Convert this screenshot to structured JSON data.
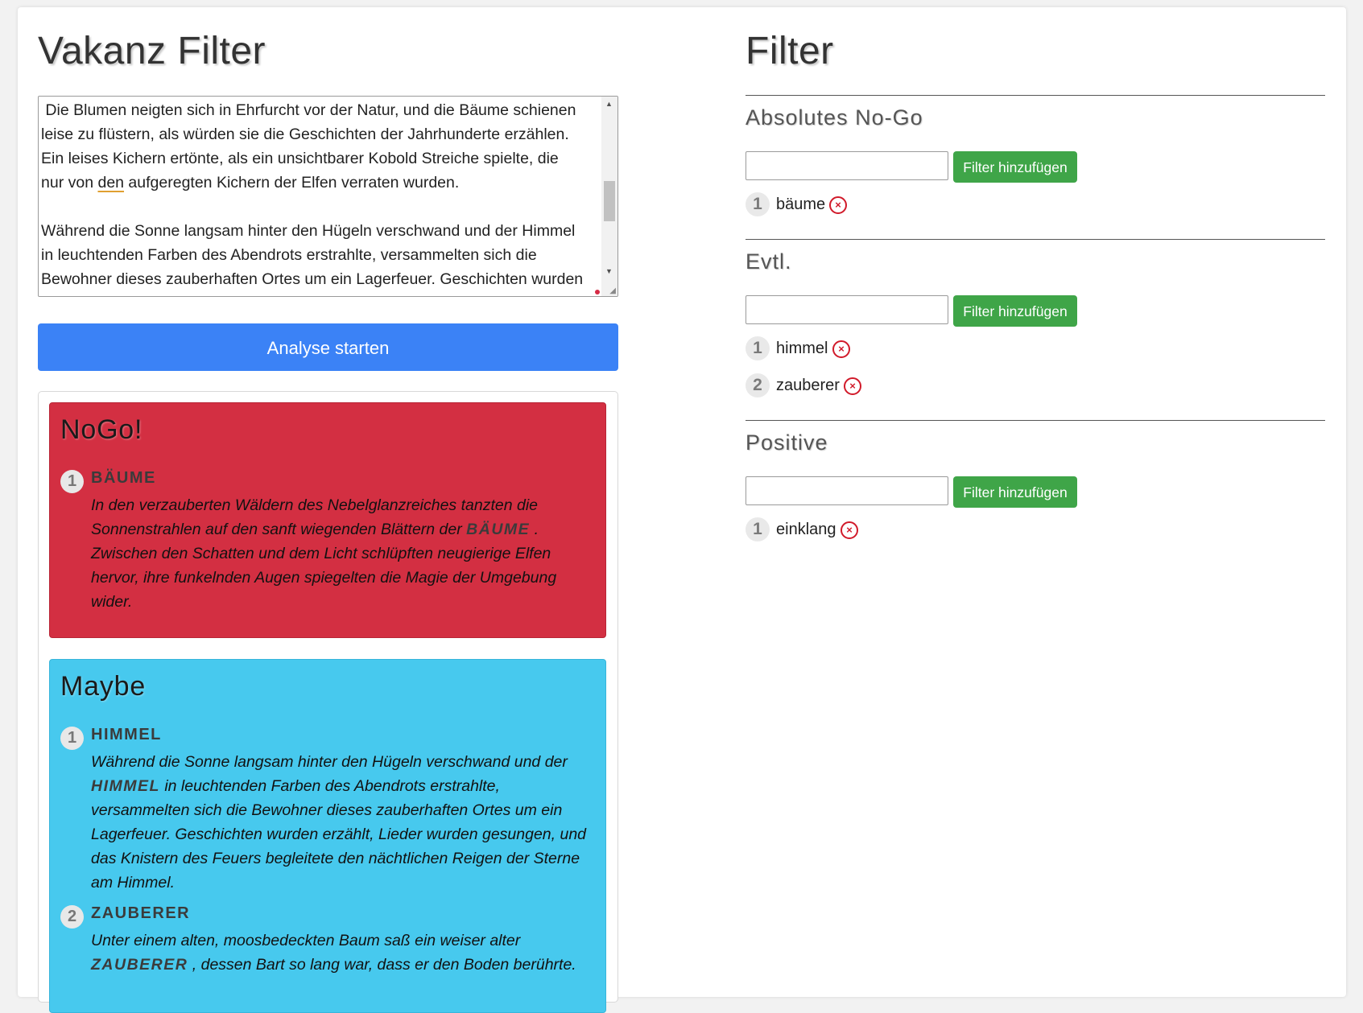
{
  "left": {
    "title": "Vakanz Filter",
    "text_lines": [
      " Die Blumen neigten sich in Ehrfurcht vor der Natur, und die Bäume schienen",
      "leise zu flüstern, als würden sie die Geschichten der Jahrhunderte erzählen.",
      "Ein leises Kichern ertönte, als ein unsichtbarer Kobold Streiche spielte, die",
      "nur von ",
      "den",
      " aufgeregten Kichern der Elfen verraten wurden.",
      "Während die Sonne langsam hinter den Hügeln verschwand und der Himmel",
      "in leuchtenden Farben des Abendrots erstrahlte, versammelten sich die",
      "Bewohner dieses zauberhaften Ortes um ein Lagerfeuer. Geschichten wurden"
    ],
    "analyse_button": "Analyse starten"
  },
  "results": {
    "nogo": {
      "title": "NoGo!",
      "color": "#d32f42",
      "hits": [
        {
          "num": "1",
          "word": "BÄUME",
          "text_before": "In den verzauberten Wäldern des Nebelglanzreiches tanzten die Sonnenstrahlen auf den sanft wiegenden Blättern der ",
          "keyword": "Bäume",
          "text_after": " . Zwischen den Schatten und dem Licht schlüpften neugierige Elfen hervor, ihre funkelnden Augen spiegelten die Magie der Umgebung wider."
        }
      ]
    },
    "maybe": {
      "title": "Maybe",
      "color": "#47c9ee",
      "hits": [
        {
          "num": "1",
          "word": "HIMMEL",
          "text_before": "Während die Sonne langsam hinter den Hügeln verschwand und der ",
          "keyword": "Himmel",
          "text_after": " in leuchtenden Farben des Abendrots erstrahlte, versammelten sich die Bewohner dieses zauberhaften Ortes um ein Lagerfeuer. Geschichten wurden erzählt, Lieder wurden gesungen, und das Knistern des Feuers begleitete den nächtlichen Reigen der Sterne am Himmel."
        },
        {
          "num": "2",
          "word": "ZAUBERER",
          "text_before": "Unter einem alten, moosbedeckten Baum saß ein weiser alter ",
          "keyword": "Zauberer",
          "text_after": " , dessen Bart so lang war, dass er den Boden berührte."
        }
      ]
    }
  },
  "filter": {
    "title": "Filter",
    "add_button": "Filter hinzufügen",
    "remove_symbol": "×",
    "sections": [
      {
        "title": "Absolutes No-Go",
        "input_value": "",
        "items": [
          {
            "num": "1",
            "label": "bäume"
          }
        ]
      },
      {
        "title": "Evtl.",
        "input_value": "",
        "items": [
          {
            "num": "1",
            "label": "himmel"
          },
          {
            "num": "2",
            "label": "zauberer"
          }
        ]
      },
      {
        "title": "Positive",
        "input_value": "",
        "items": [
          {
            "num": "1",
            "label": "einklang"
          }
        ]
      }
    ]
  },
  "colors": {
    "primary_button": "#3b82f6",
    "success_button": "#3fa548",
    "remove_icon": "#d11a2a"
  }
}
